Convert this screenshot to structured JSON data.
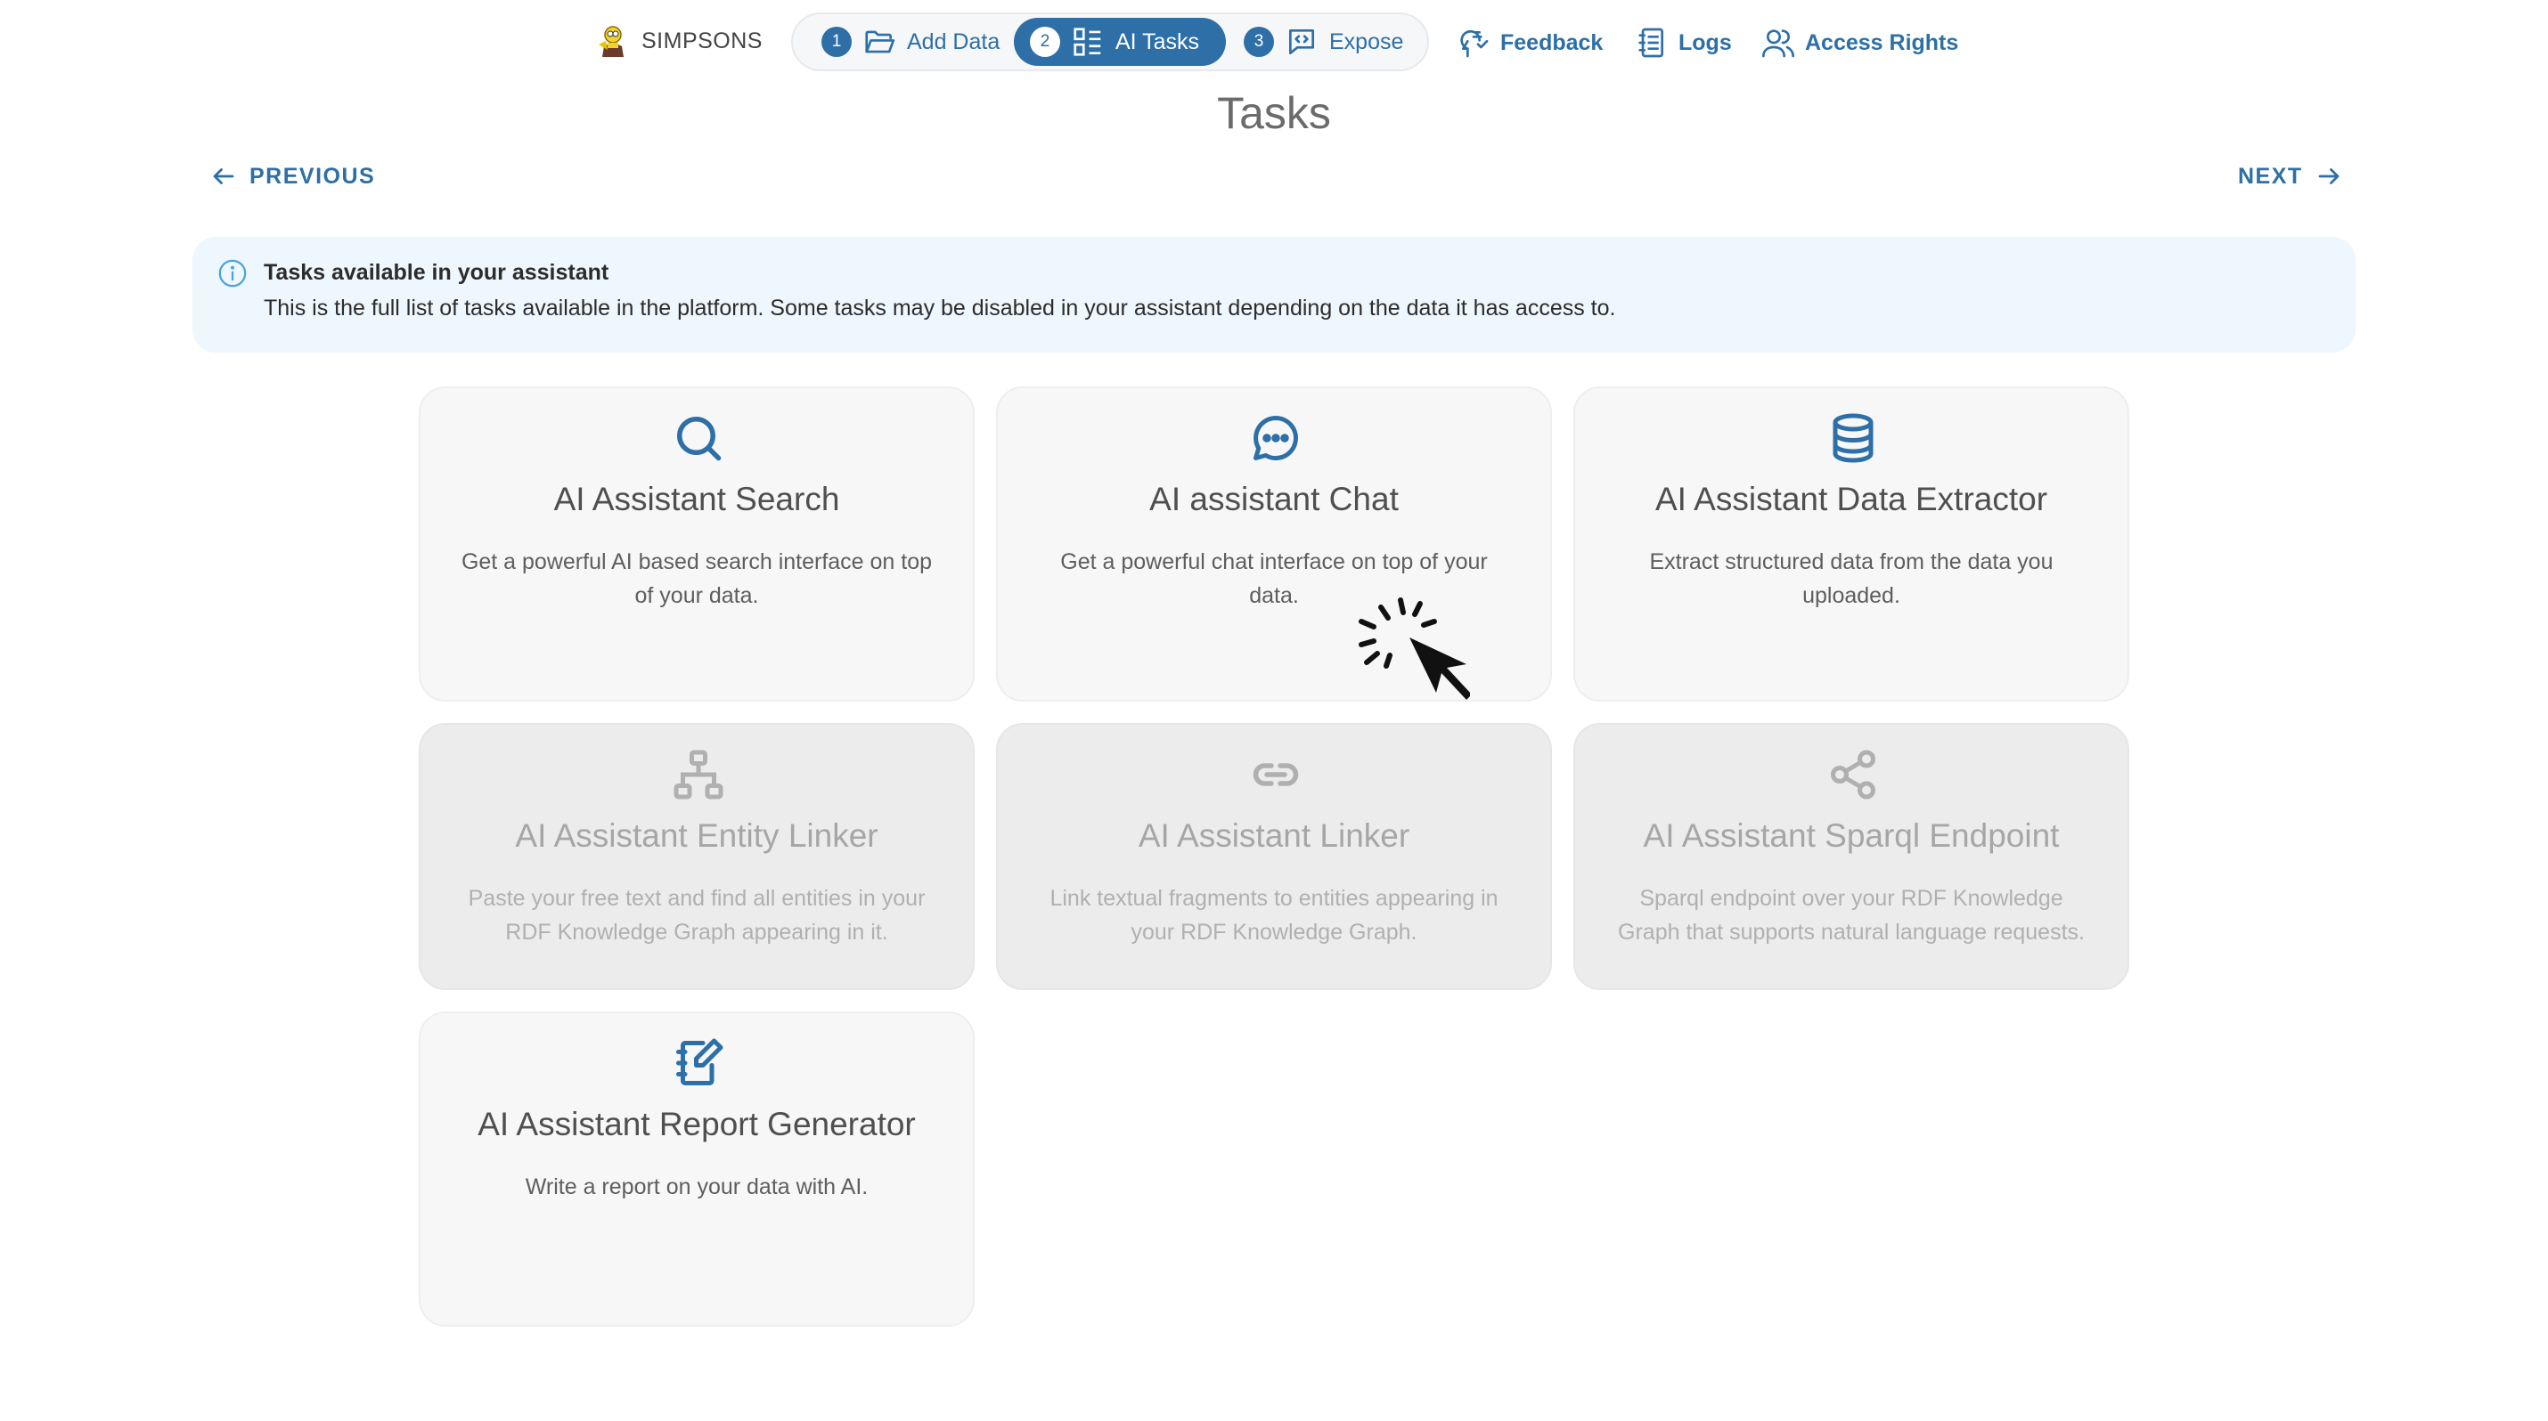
{
  "header": {
    "brand": {
      "name": "SIMPSONS"
    },
    "steps": [
      {
        "number": "1",
        "label": "Add Data",
        "icon": "folder-open-icon",
        "active": false
      },
      {
        "number": "2",
        "label": "AI Tasks",
        "icon": "dashboard-icon",
        "active": true
      },
      {
        "number": "3",
        "label": "Expose",
        "icon": "message-code-icon",
        "active": false
      }
    ],
    "nav": {
      "feedback": "Feedback",
      "logs": "Logs",
      "access_rights": "Access Rights"
    }
  },
  "page": {
    "title": "Tasks",
    "previous": "PREVIOUS",
    "next": "NEXT"
  },
  "alert": {
    "title": "Tasks available in your assistant",
    "text": "This is the full list of tasks available in the platform. Some tasks may be disabled in your assistant depending on the data it has access to."
  },
  "tasks": [
    {
      "title": "AI Assistant Search",
      "description": "Get a powerful AI based search interface on top of your data.",
      "icon": "search-icon",
      "enabled": true
    },
    {
      "title": "AI assistant Chat",
      "description": "Get a powerful chat interface on top of your data.",
      "icon": "chat-bubble-icon",
      "enabled": true
    },
    {
      "title": "AI Assistant Data Extractor",
      "description": "Extract structured data from the data you uploaded.",
      "icon": "database-icon",
      "enabled": true
    },
    {
      "title": "AI Assistant Entity Linker",
      "description": "Paste your free text and find all entities in your RDF Knowledge Graph appearing in it.",
      "icon": "hierarchy-icon",
      "enabled": false
    },
    {
      "title": "AI Assistant Linker",
      "description": "Link textual fragments to entities appearing in your RDF Knowledge Graph.",
      "icon": "link-icon",
      "enabled": false
    },
    {
      "title": "AI Assistant Sparql Endpoint",
      "description": "Sparql endpoint over your RDF Knowledge Graph that supports natural language requests.",
      "icon": "share-icon",
      "enabled": false
    },
    {
      "title": "AI Assistant Report Generator",
      "description": "Write a report on your data with AI.",
      "icon": "notebook-edit-icon",
      "enabled": true
    }
  ],
  "colors": {
    "accent": "#2d6fa6",
    "alert_bg": "#eef7fd",
    "card_bg": "#f7f7f7",
    "card_disabled_bg": "#ececec"
  }
}
